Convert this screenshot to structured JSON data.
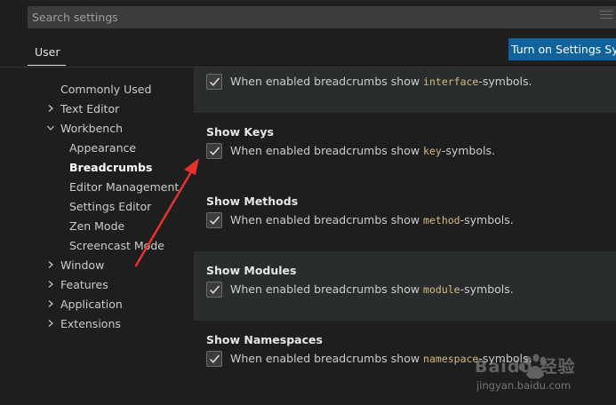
{
  "search": {
    "placeholder": "Search settings"
  },
  "tabs": {
    "user": "User"
  },
  "sync_button": "Turn on Settings Sync",
  "toc": [
    {
      "label": "Commonly Used",
      "chevron": "none"
    },
    {
      "label": "Text Editor",
      "chevron": "right"
    },
    {
      "label": "Workbench",
      "chevron": "down"
    },
    {
      "label": "Appearance",
      "chevron": "none"
    },
    {
      "label": "Breadcrumbs",
      "chevron": "none",
      "active": true
    },
    {
      "label": "Editor Management",
      "chevron": "none"
    },
    {
      "label": "Settings Editor",
      "chevron": "none"
    },
    {
      "label": "Zen Mode",
      "chevron": "none"
    },
    {
      "label": "Screencast Mode",
      "chevron": "none"
    },
    {
      "label": "Window",
      "chevron": "right"
    },
    {
      "label": "Features",
      "chevron": "right"
    },
    {
      "label": "Application",
      "chevron": "right"
    },
    {
      "label": "Extensions",
      "chevron": "right"
    }
  ],
  "settings": {
    "interfaces": {
      "prefix": "When enabled breadcrumbs show ",
      "code": "interface",
      "suffix": "-symbols.",
      "checked": true
    },
    "keys": {
      "title": "Show Keys",
      "prefix": "When enabled breadcrumbs show ",
      "code": "key",
      "suffix": "-symbols.",
      "checked": true
    },
    "methods": {
      "title": "Show Methods",
      "prefix": "When enabled breadcrumbs show ",
      "code": "method",
      "suffix": "-symbols.",
      "checked": true
    },
    "modules": {
      "title": "Show Modules",
      "prefix": "When enabled breadcrumbs show ",
      "code": "module",
      "suffix": "-symbols.",
      "checked": true
    },
    "namespaces": {
      "title": "Show Namespaces",
      "prefix": "When enabled breadcrumbs show ",
      "code": "namespace",
      "suffix": "-symbols.",
      "checked": true
    }
  },
  "watermark": {
    "brand": "Baidu 经验",
    "url": "jingyan.baidu.com"
  },
  "colors": {
    "accent": "#0e639c",
    "annotation_arrow": "#e8312f",
    "code": "#d7ba7d",
    "background": "#1e1e1e"
  }
}
